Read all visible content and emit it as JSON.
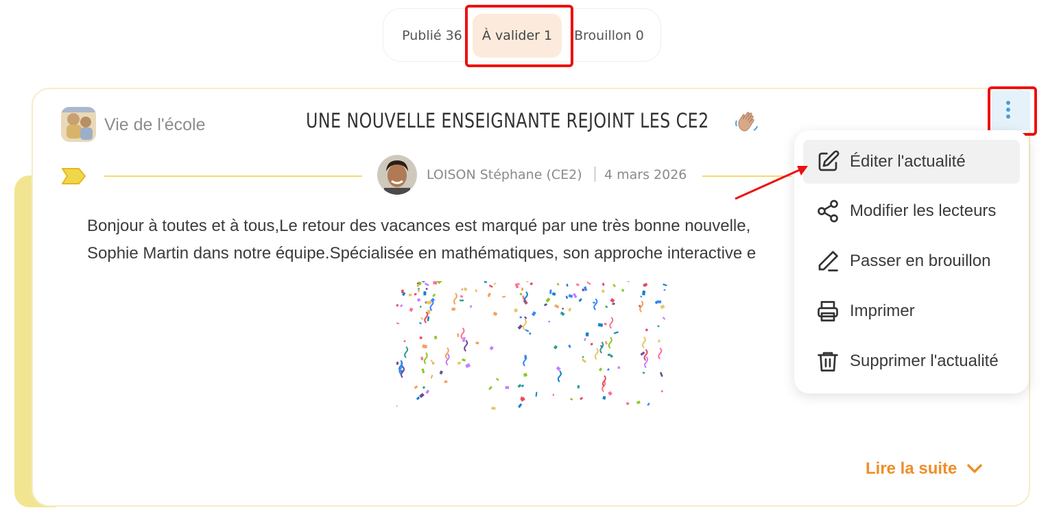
{
  "tabs": [
    {
      "label": "Publié 36"
    },
    {
      "label": "À valider 1"
    },
    {
      "label": "Brouillon 0"
    }
  ],
  "post": {
    "category": "Vie de l'école",
    "title": "UNE NOUVELLE ENSEIGNANTE REJOINT LES CE2",
    "author": "LOISON Stéphane (CE2)",
    "date": "4 mars 2026",
    "body_line1": "Bonjour à toutes et à tous,Le retour des vacances est marqué par une très bonne nouvelle,",
    "body_line2": "Sophie Martin dans notre équipe.Spécialisée en mathématiques, son approche interactive e",
    "read_more": "Lire la suite"
  },
  "menu": {
    "items": [
      {
        "label": "Éditer l'actualité",
        "icon": "edit-icon"
      },
      {
        "label": "Modifier les lecteurs",
        "icon": "share-icon"
      },
      {
        "label": "Passer en brouillon",
        "icon": "pen-icon"
      },
      {
        "label": "Imprimer",
        "icon": "printer-icon"
      },
      {
        "label": "Supprimer l'actualité",
        "icon": "trash-icon"
      }
    ]
  },
  "colors": {
    "accent": "#ef8e27",
    "tab_active_bg": "#fcebdc",
    "highlight": "#ee0f0f",
    "card_stripe": "#f2e592",
    "menu_btn": "#e6f2fa"
  }
}
